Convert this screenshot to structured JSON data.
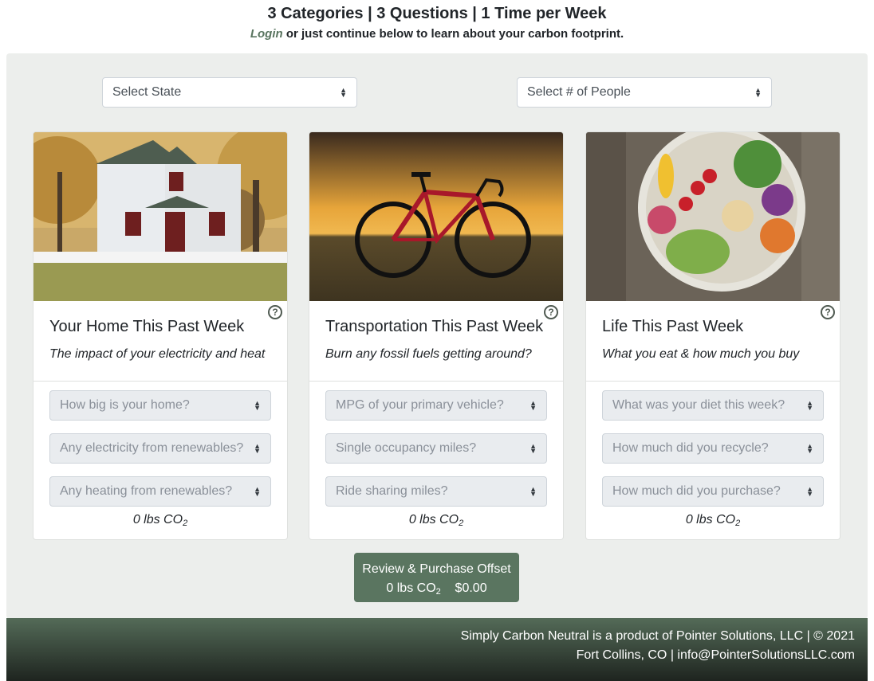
{
  "header": {
    "title": "3 Categories | 3 Questions | 1 Time per Week",
    "login_link": "Login",
    "subtitle_rest": " or just continue below to learn about your carbon footprint."
  },
  "top_selects": {
    "state": "Select State",
    "people": "Select # of People"
  },
  "cards": [
    {
      "title": "Your Home This Past Week",
      "description": "The impact of your electricity and heat",
      "questions": [
        "How big is your home?",
        "Any electricity from renewables?",
        "Any heating from renewables?"
      ],
      "total": "0 lbs CO",
      "total_sub": "2"
    },
    {
      "title": "Transportation This Past Week",
      "description": "Burn any fossil fuels getting around?",
      "questions": [
        "MPG of your primary vehicle?",
        "Single occupancy miles?",
        "Ride sharing miles?"
      ],
      "total": "0 lbs CO",
      "total_sub": "2"
    },
    {
      "title": "Life This Past Week",
      "description": "What you eat & how much you buy",
      "questions": [
        "What was your diet this week?",
        "How much did you recycle?",
        "How much did you purchase?"
      ],
      "total": "0 lbs CO",
      "total_sub": "2"
    }
  ],
  "help_glyph": "?",
  "review": {
    "label": "Review & Purchase Offset",
    "co2": "0 lbs CO",
    "co2_sub": "2",
    "price": "$0.00"
  },
  "footer": {
    "line1": "Simply Carbon Neutral is a product of Pointer Solutions, LLC | © 2021",
    "line2": "Fort Collins, CO | info@PointerSolutionsLLC.com"
  },
  "colors": {
    "accent": "#5a7560",
    "panel_bg": "#eceeec",
    "footer_top": "#546b58",
    "footer_bottom": "#1e241f"
  }
}
